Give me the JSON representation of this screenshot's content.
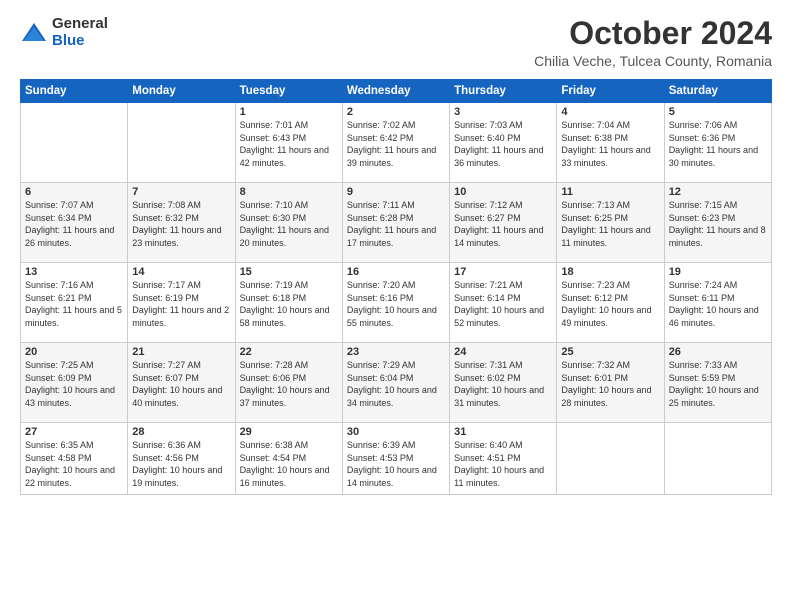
{
  "logo": {
    "general": "General",
    "blue": "Blue"
  },
  "title": "October 2024",
  "subtitle": "Chilia Veche, Tulcea County, Romania",
  "days_of_week": [
    "Sunday",
    "Monday",
    "Tuesday",
    "Wednesday",
    "Thursday",
    "Friday",
    "Saturday"
  ],
  "weeks": [
    [
      {
        "day": "",
        "sunrise": "",
        "sunset": "",
        "daylight": ""
      },
      {
        "day": "",
        "sunrise": "",
        "sunset": "",
        "daylight": ""
      },
      {
        "day": "1",
        "sunrise": "Sunrise: 7:01 AM",
        "sunset": "Sunset: 6:43 PM",
        "daylight": "Daylight: 11 hours and 42 minutes."
      },
      {
        "day": "2",
        "sunrise": "Sunrise: 7:02 AM",
        "sunset": "Sunset: 6:42 PM",
        "daylight": "Daylight: 11 hours and 39 minutes."
      },
      {
        "day": "3",
        "sunrise": "Sunrise: 7:03 AM",
        "sunset": "Sunset: 6:40 PM",
        "daylight": "Daylight: 11 hours and 36 minutes."
      },
      {
        "day": "4",
        "sunrise": "Sunrise: 7:04 AM",
        "sunset": "Sunset: 6:38 PM",
        "daylight": "Daylight: 11 hours and 33 minutes."
      },
      {
        "day": "5",
        "sunrise": "Sunrise: 7:06 AM",
        "sunset": "Sunset: 6:36 PM",
        "daylight": "Daylight: 11 hours and 30 minutes."
      }
    ],
    [
      {
        "day": "6",
        "sunrise": "Sunrise: 7:07 AM",
        "sunset": "Sunset: 6:34 PM",
        "daylight": "Daylight: 11 hours and 26 minutes."
      },
      {
        "day": "7",
        "sunrise": "Sunrise: 7:08 AM",
        "sunset": "Sunset: 6:32 PM",
        "daylight": "Daylight: 11 hours and 23 minutes."
      },
      {
        "day": "8",
        "sunrise": "Sunrise: 7:10 AM",
        "sunset": "Sunset: 6:30 PM",
        "daylight": "Daylight: 11 hours and 20 minutes."
      },
      {
        "day": "9",
        "sunrise": "Sunrise: 7:11 AM",
        "sunset": "Sunset: 6:28 PM",
        "daylight": "Daylight: 11 hours and 17 minutes."
      },
      {
        "day": "10",
        "sunrise": "Sunrise: 7:12 AM",
        "sunset": "Sunset: 6:27 PM",
        "daylight": "Daylight: 11 hours and 14 minutes."
      },
      {
        "day": "11",
        "sunrise": "Sunrise: 7:13 AM",
        "sunset": "Sunset: 6:25 PM",
        "daylight": "Daylight: 11 hours and 11 minutes."
      },
      {
        "day": "12",
        "sunrise": "Sunrise: 7:15 AM",
        "sunset": "Sunset: 6:23 PM",
        "daylight": "Daylight: 11 hours and 8 minutes."
      }
    ],
    [
      {
        "day": "13",
        "sunrise": "Sunrise: 7:16 AM",
        "sunset": "Sunset: 6:21 PM",
        "daylight": "Daylight: 11 hours and 5 minutes."
      },
      {
        "day": "14",
        "sunrise": "Sunrise: 7:17 AM",
        "sunset": "Sunset: 6:19 PM",
        "daylight": "Daylight: 11 hours and 2 minutes."
      },
      {
        "day": "15",
        "sunrise": "Sunrise: 7:19 AM",
        "sunset": "Sunset: 6:18 PM",
        "daylight": "Daylight: 10 hours and 58 minutes."
      },
      {
        "day": "16",
        "sunrise": "Sunrise: 7:20 AM",
        "sunset": "Sunset: 6:16 PM",
        "daylight": "Daylight: 10 hours and 55 minutes."
      },
      {
        "day": "17",
        "sunrise": "Sunrise: 7:21 AM",
        "sunset": "Sunset: 6:14 PM",
        "daylight": "Daylight: 10 hours and 52 minutes."
      },
      {
        "day": "18",
        "sunrise": "Sunrise: 7:23 AM",
        "sunset": "Sunset: 6:12 PM",
        "daylight": "Daylight: 10 hours and 49 minutes."
      },
      {
        "day": "19",
        "sunrise": "Sunrise: 7:24 AM",
        "sunset": "Sunset: 6:11 PM",
        "daylight": "Daylight: 10 hours and 46 minutes."
      }
    ],
    [
      {
        "day": "20",
        "sunrise": "Sunrise: 7:25 AM",
        "sunset": "Sunset: 6:09 PM",
        "daylight": "Daylight: 10 hours and 43 minutes."
      },
      {
        "day": "21",
        "sunrise": "Sunrise: 7:27 AM",
        "sunset": "Sunset: 6:07 PM",
        "daylight": "Daylight: 10 hours and 40 minutes."
      },
      {
        "day": "22",
        "sunrise": "Sunrise: 7:28 AM",
        "sunset": "Sunset: 6:06 PM",
        "daylight": "Daylight: 10 hours and 37 minutes."
      },
      {
        "day": "23",
        "sunrise": "Sunrise: 7:29 AM",
        "sunset": "Sunset: 6:04 PM",
        "daylight": "Daylight: 10 hours and 34 minutes."
      },
      {
        "day": "24",
        "sunrise": "Sunrise: 7:31 AM",
        "sunset": "Sunset: 6:02 PM",
        "daylight": "Daylight: 10 hours and 31 minutes."
      },
      {
        "day": "25",
        "sunrise": "Sunrise: 7:32 AM",
        "sunset": "Sunset: 6:01 PM",
        "daylight": "Daylight: 10 hours and 28 minutes."
      },
      {
        "day": "26",
        "sunrise": "Sunrise: 7:33 AM",
        "sunset": "Sunset: 5:59 PM",
        "daylight": "Daylight: 10 hours and 25 minutes."
      }
    ],
    [
      {
        "day": "27",
        "sunrise": "Sunrise: 6:35 AM",
        "sunset": "Sunset: 4:58 PM",
        "daylight": "Daylight: 10 hours and 22 minutes."
      },
      {
        "day": "28",
        "sunrise": "Sunrise: 6:36 AM",
        "sunset": "Sunset: 4:56 PM",
        "daylight": "Daylight: 10 hours and 19 minutes."
      },
      {
        "day": "29",
        "sunrise": "Sunrise: 6:38 AM",
        "sunset": "Sunset: 4:54 PM",
        "daylight": "Daylight: 10 hours and 16 minutes."
      },
      {
        "day": "30",
        "sunrise": "Sunrise: 6:39 AM",
        "sunset": "Sunset: 4:53 PM",
        "daylight": "Daylight: 10 hours and 14 minutes."
      },
      {
        "day": "31",
        "sunrise": "Sunrise: 6:40 AM",
        "sunset": "Sunset: 4:51 PM",
        "daylight": "Daylight: 10 hours and 11 minutes."
      },
      {
        "day": "",
        "sunrise": "",
        "sunset": "",
        "daylight": ""
      },
      {
        "day": "",
        "sunrise": "",
        "sunset": "",
        "daylight": ""
      }
    ]
  ]
}
